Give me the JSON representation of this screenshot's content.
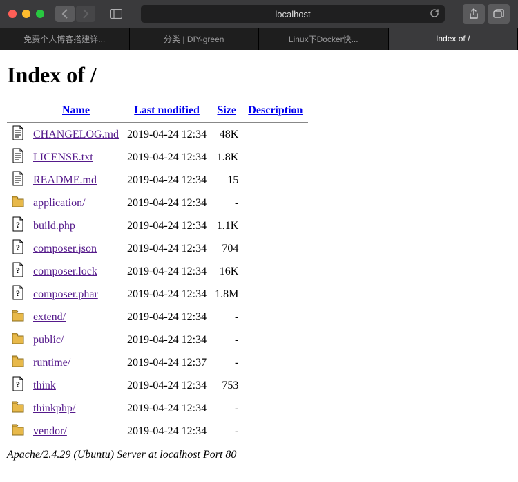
{
  "browser": {
    "url": "localhost"
  },
  "tabs": [
    {
      "label": "免费个人博客搭建详...",
      "active": false
    },
    {
      "label": "分类 | DIY-green",
      "active": false
    },
    {
      "label": "Linux下Docker快...",
      "active": false
    },
    {
      "label": "Index of /",
      "active": true
    }
  ],
  "page": {
    "title": "Index of /",
    "headers": {
      "name": "Name",
      "modified": "Last modified",
      "size": "Size",
      "description": "Description"
    },
    "files": [
      {
        "icon": "text",
        "name": "CHANGELOG.md",
        "modified": "2019-04-24 12:34",
        "size": "48K"
      },
      {
        "icon": "text",
        "name": "LICENSE.txt",
        "modified": "2019-04-24 12:34",
        "size": "1.8K"
      },
      {
        "icon": "text",
        "name": "README.md",
        "modified": "2019-04-24 12:34",
        "size": "15"
      },
      {
        "icon": "folder",
        "name": "application/",
        "modified": "2019-04-24 12:34",
        "size": "-"
      },
      {
        "icon": "unknown",
        "name": "build.php",
        "modified": "2019-04-24 12:34",
        "size": "1.1K"
      },
      {
        "icon": "unknown",
        "name": "composer.json",
        "modified": "2019-04-24 12:34",
        "size": "704"
      },
      {
        "icon": "unknown",
        "name": "composer.lock",
        "modified": "2019-04-24 12:34",
        "size": "16K"
      },
      {
        "icon": "unknown",
        "name": "composer.phar",
        "modified": "2019-04-24 12:34",
        "size": "1.8M"
      },
      {
        "icon": "folder",
        "name": "extend/",
        "modified": "2019-04-24 12:34",
        "size": "-"
      },
      {
        "icon": "folder",
        "name": "public/",
        "modified": "2019-04-24 12:34",
        "size": "-"
      },
      {
        "icon": "folder",
        "name": "runtime/",
        "modified": "2019-04-24 12:37",
        "size": "-"
      },
      {
        "icon": "unknown",
        "name": "think",
        "modified": "2019-04-24 12:34",
        "size": "753"
      },
      {
        "icon": "folder",
        "name": "thinkphp/",
        "modified": "2019-04-24 12:34",
        "size": "-"
      },
      {
        "icon": "folder",
        "name": "vendor/",
        "modified": "2019-04-24 12:34",
        "size": "-"
      }
    ],
    "footer": "Apache/2.4.29 (Ubuntu) Server at localhost Port 80"
  }
}
